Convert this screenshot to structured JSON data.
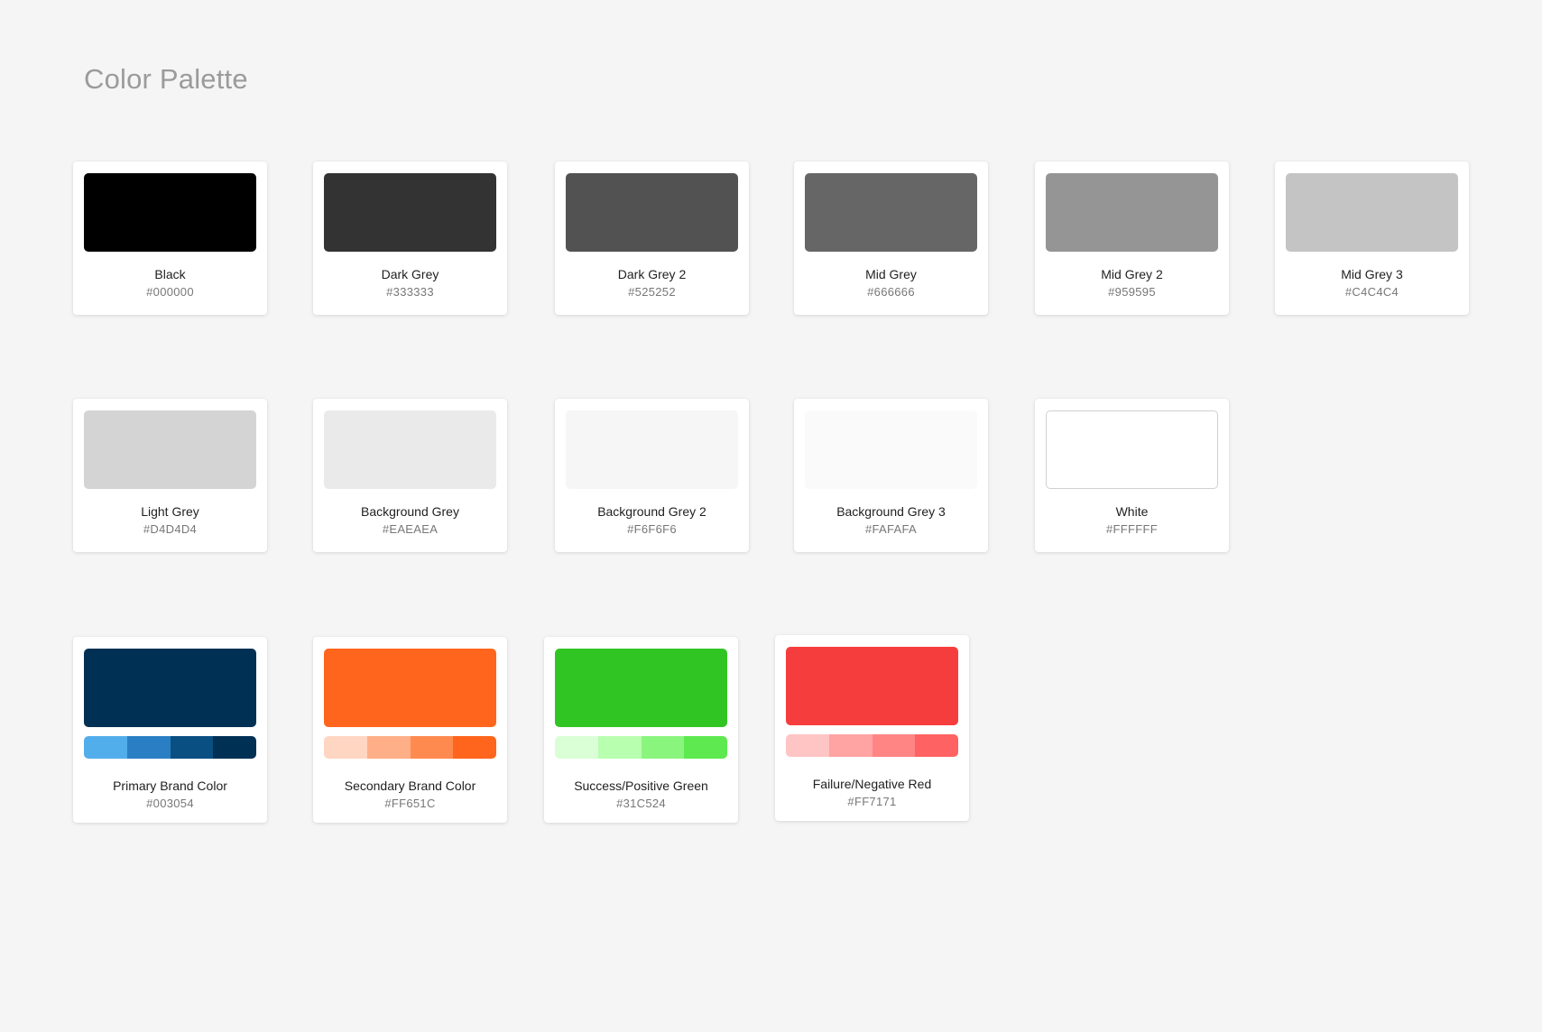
{
  "page": {
    "title": "Color Palette"
  },
  "greys": [
    {
      "name": "Black",
      "hex": "#000000",
      "color": "#000000"
    },
    {
      "name": "Dark Grey",
      "hex": "#333333",
      "color": "#333333"
    },
    {
      "name": "Dark Grey 2",
      "hex": "#525252",
      "color": "#525252"
    },
    {
      "name": "Mid Grey",
      "hex": "#666666",
      "color": "#666666"
    },
    {
      "name": "Mid Grey 2",
      "hex": "#959595",
      "color": "#959595"
    },
    {
      "name": "Mid Grey 3",
      "hex": "#C4C4C4",
      "color": "#C4C4C4"
    }
  ],
  "lights": [
    {
      "name": "Light Grey",
      "hex": "#D4D4D4",
      "color": "#D4D4D4"
    },
    {
      "name": "Background Grey",
      "hex": "#EAEAEA",
      "color": "#EAEAEA"
    },
    {
      "name": "Background Grey 2",
      "hex": "#F6F6F6",
      "color": "#F6F6F6"
    },
    {
      "name": "Background Grey 3",
      "hex": "#FAFAFA",
      "color": "#FAFAFA"
    },
    {
      "name": "White",
      "hex": "#FFFFFF",
      "color": "#FFFFFF"
    }
  ],
  "brand": [
    {
      "name": "Primary Brand Color",
      "hex": "#003054",
      "color": "#003054",
      "shades": [
        "#52ADEB",
        "#2A7FC4",
        "#0A4F82",
        "#003054"
      ]
    },
    {
      "name": "Secondary Brand Color",
      "hex": "#FF651C",
      "color": "#FF651C",
      "shades": [
        "#FFD6C2",
        "#FFAF87",
        "#FF8A4F",
        "#FF651C"
      ]
    },
    {
      "name": "Success/Positive Green",
      "hex": "#31C524",
      "color": "#31C524",
      "shades": [
        "#DAFFD6",
        "#B8FFB0",
        "#8AF57D",
        "#5DE94F"
      ]
    },
    {
      "name": "Failure/Negative Red",
      "hex": "#FF7171",
      "color": "#F63D3D",
      "shades": [
        "#FFC4C4",
        "#FFA3A3",
        "#FF8585",
        "#FF6262"
      ]
    }
  ]
}
